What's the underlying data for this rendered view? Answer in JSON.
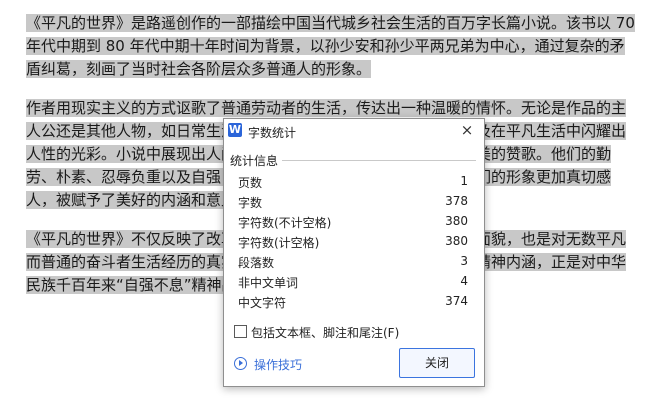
{
  "document": {
    "paragraph1": "《平凡的世界》是路遥创作的一部描绘中国当代城乡社会生活的百万字长篇小说。该书以 70 年代中期到 80 年代中期十年时间为背景，以孙少安和孙少平两兄弟为中心，通过复杂的矛盾纠葛，刻画了当时社会各阶层众多普通人的形象。",
    "paragraph2": "作者用现实主义的方式讴歌了普通劳动者的生活，传达出一种温暖的情怀。无论是作品的主人公还是其他人物，如日常生活中的小人物，都有着美好的心灵，以及在平凡生活中闪耀出人性的光彩。小说中展现出人间亲情、爱情、友情，谱写了一曲人性美的赞歌。他们的勤劳、朴素、忍辱负重以及自强自立，勇于和命运作斗争的精神，让他们的形象更加真切感人，被赋予了美好的内涵和意义。",
    "paragraph3": "《平凡的世界》不仅反映了改革开放初期中国农村和城市的社会现实面貌，也是对无数平凡而普通的奋斗者生活经历的真实写照，作品蕴含着作者想要传达出的精神内涵，正是对中华民族千百年来“自强不息”精神品格的传承与弘扬之体现。"
  },
  "dialog": {
    "title": "字数统计",
    "app_icon": "W",
    "group_label": "统计信息",
    "stats": [
      {
        "label": "页数",
        "value": "1"
      },
      {
        "label": "字数",
        "value": "378"
      },
      {
        "label": "字符数(不计空格)",
        "value": "380"
      },
      {
        "label": "字符数(计空格)",
        "value": "380"
      },
      {
        "label": "段落数",
        "value": "3"
      },
      {
        "label": "非中文单词",
        "value": "4"
      },
      {
        "label": "中文字符",
        "value": "374"
      }
    ],
    "checkbox_label": "包括文本框、脚注和尾注(F)",
    "checkbox_checked": false,
    "tips_label": "操作技巧",
    "close_button": "关闭",
    "close_icon": "×"
  },
  "colors": {
    "selection": "#c8c8c8",
    "accent": "#3a6fd8",
    "app_icon_bg": "#2b65d9"
  }
}
